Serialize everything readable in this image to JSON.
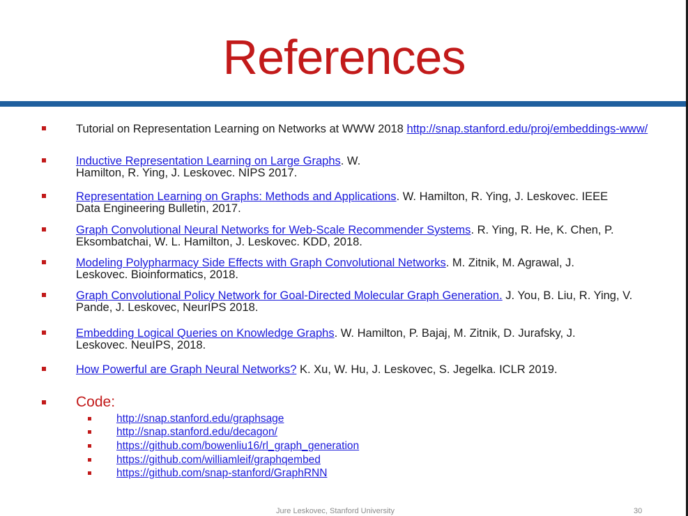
{
  "slide": {
    "title": "References",
    "footer": "Jure Leskovec, Stanford University",
    "page_number": "30",
    "colors": {
      "title": "#c21a1a",
      "rule": "#1f5f9e",
      "link": "#1a1adb",
      "bullet": "#c21a1a"
    }
  },
  "refs": [
    {
      "pre": "Tutorial on Representation Learning on Networks at WWW 2018 ",
      "link": "http://snap.stanford.edu/proj/embeddings-www/",
      "post": ""
    },
    {
      "pre": "",
      "link": "Inductive Representation Learning on Large Graphs",
      "post": ". W. Hamilton, R. Ying, J. Leskovec. NIPS 2017."
    },
    {
      "pre": "",
      "link": "Representation Learning on Graphs: Methods and Applications",
      "post": ". W. Hamilton, R. Ying, J. Leskovec. IEEE Data Engineering Bulletin, 2017."
    },
    {
      "pre": "",
      "link": "Graph Convolutional Neural Networks for Web-Scale Recommender Systems",
      "post": ". R. Ying, R. He, K. Chen, P. Eksombatchai, W. L. Hamilton, J. Leskovec. KDD, 2018."
    },
    {
      "pre": "",
      "link": "Modeling Polypharmacy Side Effects with Graph Convolutional Networks",
      "post": ". M. Zitnik, M. Agrawal, J. Leskovec. Bioinformatics, 2018."
    },
    {
      "pre": "",
      "link": "Graph Convolutional Policy Network for Goal-Directed Molecular Graph Generation.",
      "post": " J. You, B. Liu, R. Ying, V. Pande, J. Leskovec, NeurIPS 2018."
    },
    {
      "pre": "",
      "link": "Embedding Logical Queries on Knowledge Graphs",
      "post": ". W. Hamilton, P. Bajaj, M. Zitnik, D. Jurafsky, J. Leskovec. NeuIPS, 2018."
    },
    {
      "pre": "",
      "link": "How Powerful are Graph Neural Networks?",
      "post": " K. Xu, W. Hu, J. Leskovec, S. Jegelka. ICLR 2019."
    }
  ],
  "code": {
    "label": "Code:",
    "links": [
      "http://snap.stanford.edu/graphsage",
      "http://snap.stanford.edu/decagon/",
      "https://github.com/bowenliu16/rl_graph_generation",
      "https://github.com/williamleif/graphqembed",
      "https://github.com/snap-stanford/GraphRNN"
    ]
  }
}
